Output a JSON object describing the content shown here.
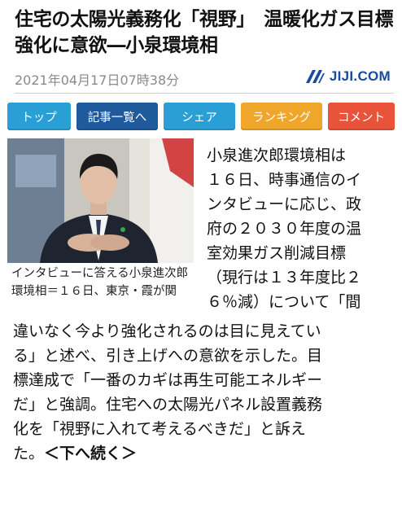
{
  "article": {
    "headline": "住宅の太陽光義務化「視野」　温暖化ガス目標強化に意欲―小泉環境相",
    "timestamp": "2021年04月17日07時38分",
    "logo_text": "JIJI.COM"
  },
  "nav": {
    "buttons": [
      {
        "label": "トップ",
        "color": "#2a9fd6"
      },
      {
        "label": "記事一覧へ",
        "color": "#1e5a9c"
      },
      {
        "label": "シェア",
        "color": "#2a9fd6"
      },
      {
        "label": "ランキング",
        "color": "#f0a52b"
      },
      {
        "label": "コメント",
        "color": "#e8533a"
      }
    ]
  },
  "photo": {
    "caption": "インタビューに答える小泉進次郎環境相＝１６日、東京・霞が関"
  },
  "body": {
    "right_lines": [
      "小泉進次郎環境相は",
      "１６日、時事通信のイ",
      "ンタビューに応じ、政",
      "府の２０３０年度の温",
      "室効果ガス削減目標",
      "（現行は１３年度比２",
      "６％減）について「間"
    ],
    "full_lines": [
      "違いなく今より強化されるのは目に見えてい",
      "る」と述べ、引き上げへの意欲を示した。目",
      "標達成で「一番のカギは再生可能エネルギー",
      "だ」と強調。住宅への太陽光パネル設置義務",
      "化を「視野に入れて考えるべきだ」と訴え"
    ],
    "last_line_text": "た。",
    "more_link": "＜下へ続く＞"
  }
}
